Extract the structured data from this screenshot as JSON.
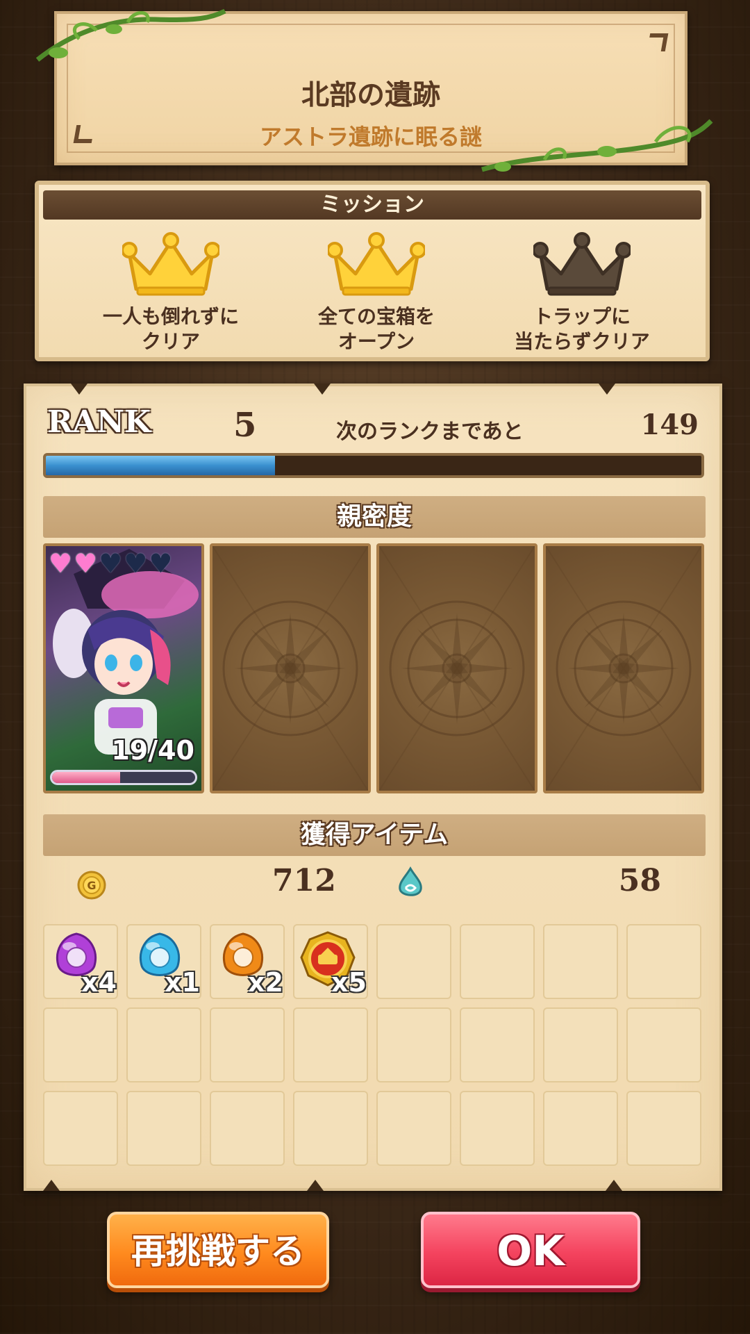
{
  "stage": {
    "title": "北部の遺跡",
    "subtitle": "アストラ遺跡に眠る謎"
  },
  "missions": {
    "header": "ミッション",
    "items": [
      {
        "line1": "一人も倒れずに",
        "line2": "クリア",
        "achieved": true
      },
      {
        "line1": "全ての宝箱を",
        "line2": "オープン",
        "achieved": true
      },
      {
        "line1": "トラップに",
        "line2": "当たらずクリア",
        "achieved": false
      }
    ]
  },
  "rank": {
    "label": "RANK",
    "value": "5",
    "next_label": "次のランクまであと",
    "next_value": "149",
    "progress": 0.35
  },
  "affinity": {
    "header": "親密度",
    "character": {
      "hearts_filled": 2,
      "hearts_total": 5,
      "progress_text": "19/40",
      "progress": 0.475
    }
  },
  "items": {
    "header": "獲得アイテム",
    "coin_icon": "gold-coin-icon",
    "coin_value": "712",
    "exp_icon": "spirit-drop-icon",
    "exp_value": "58",
    "drops": [
      {
        "icon": "purple-gem-icon",
        "qty": "x4",
        "color": "#b040d8"
      },
      {
        "icon": "blue-gem-icon",
        "qty": "x1",
        "color": "#38b8e8"
      },
      {
        "icon": "orange-gem-icon",
        "qty": "x2",
        "color": "#f08a18"
      },
      {
        "icon": "gold-medal-icon",
        "qty": "x5",
        "color": "#d8a018"
      }
    ]
  },
  "buttons": {
    "retry": "再挑戦する",
    "ok": "OK"
  }
}
